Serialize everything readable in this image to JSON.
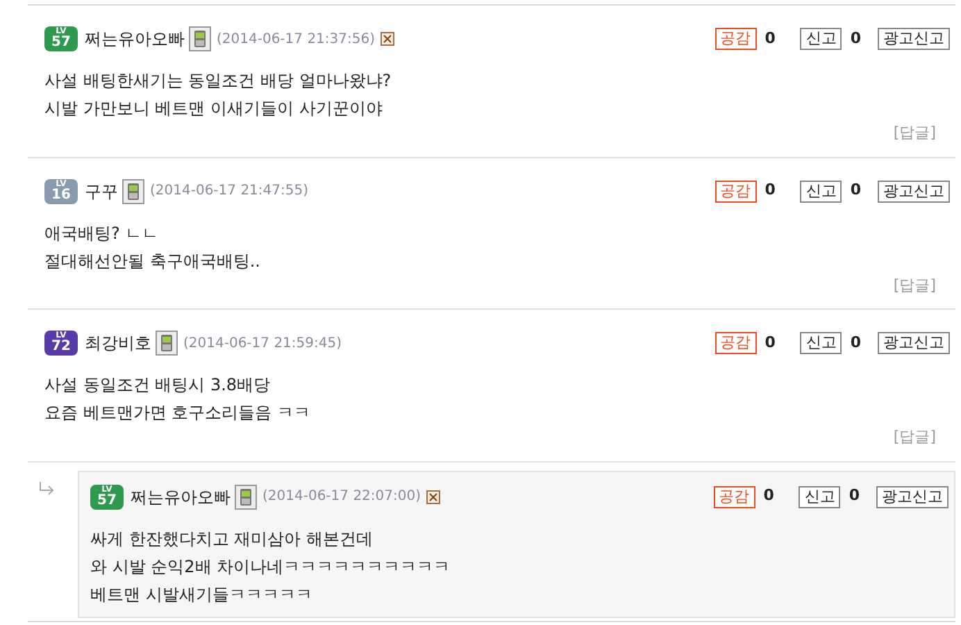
{
  "comments": [
    {
      "kind": "comment",
      "level_label": "LV",
      "level": "57",
      "color": "#2e9a4e",
      "nickname": "쩌는유아오빠",
      "date": "(2014-06-17 21:37:56)",
      "flagged": true,
      "like_label": "공감",
      "like_count": "0",
      "report_label": "신고",
      "report_count": "0",
      "ad_report_label": "광고신고",
      "lines": [
        "사설 배팅한새기는 동일조건 배당 얼마나왔냐?",
        "시발 가만보니 베트맨 이새기들이 사기꾼이야"
      ],
      "reply_label": "[답글]"
    },
    {
      "kind": "comment",
      "level_label": "LV",
      "level": "16",
      "color": "#8a9aae",
      "nickname": "구꾸",
      "date": "(2014-06-17 21:47:55)",
      "flagged": false,
      "like_label": "공감",
      "like_count": "0",
      "report_label": "신고",
      "report_count": "0",
      "ad_report_label": "광고신고",
      "lines": [
        "애국배팅? ㄴㄴ",
        "절대해선안될 축구애국배팅.."
      ],
      "reply_label": "[답글]"
    },
    {
      "kind": "comment",
      "level_label": "LV",
      "level": "72",
      "color": "#5a3aa6",
      "nickname": "최강비호",
      "date": "(2014-06-17 21:59:45)",
      "flagged": false,
      "like_label": "공감",
      "like_count": "0",
      "report_label": "신고",
      "report_count": "0",
      "ad_report_label": "광고신고",
      "lines": [
        "사설 동일조건 배팅시 3.8배당",
        "요즘 베트맨가면 호구소리들음 ㅋㅋ"
      ],
      "reply_label": "[답글]"
    },
    {
      "kind": "reply",
      "level_label": "LV",
      "level": "57",
      "color": "#2e9a4e",
      "nickname": "쩌는유아오빠",
      "date": "(2014-06-17 22:07:00)",
      "flagged": true,
      "like_label": "공감",
      "like_count": "0",
      "report_label": "신고",
      "report_count": "0",
      "ad_report_label": "광고신고",
      "lines": [
        "싸게 한잔했다치고 재미삼아 해본건데",
        "와 시발 순익2배 차이나네ㅋㅋㅋㅋㅋㅋㅋㅋㅋㅋ",
        "베트맨 시발새기들ㅋㅋㅋㅋㅋ"
      ]
    }
  ]
}
